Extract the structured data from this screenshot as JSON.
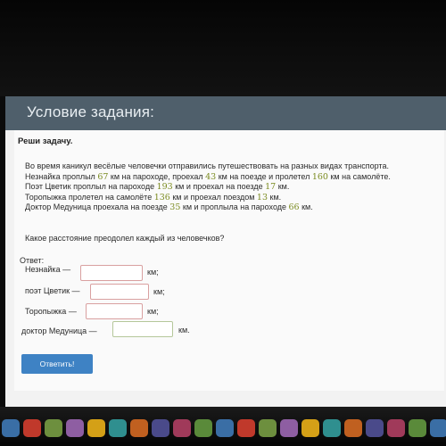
{
  "header": {
    "title": "Условие задания:"
  },
  "task": {
    "instruction": "Реши задачу.",
    "lines": [
      [
        "Во время каникул весёлые человечки отправились путешествовать на разных видах транспорта."
      ],
      [
        "Незнайка проплыл ",
        "67",
        " км на пароходе, проехал ",
        "43",
        " км на поезде и пролетел ",
        "160",
        " км на самолёте."
      ],
      [
        "Поэт Цветик проплыл на пароходе ",
        "193",
        " км и проехал на поезде ",
        "17",
        " км."
      ],
      [
        "Торопыжка пролетел на самолёте ",
        "136",
        " км и проехал поездом ",
        "13",
        " км."
      ],
      [
        "Доктор Медуница проехала на поезде ",
        "35",
        " км и проплыла на пароходе ",
        "66",
        " км."
      ]
    ],
    "question": "Какое расстояние преодолел каждый из человечков?"
  },
  "answers": {
    "title": "Ответ:",
    "rows": [
      {
        "label": "Незнайка —",
        "value": "",
        "unit": "км;"
      },
      {
        "label": "поэт Цветик —",
        "value": "",
        "unit": "км;"
      },
      {
        "label": "Торопыжка —",
        "value": "",
        "unit": "км;"
      },
      {
        "label": "доктор Медуница —",
        "value": "",
        "unit": "км."
      }
    ]
  },
  "submit_label": "Ответить!",
  "colors": {
    "header": "#4f5f6b",
    "button": "#3e82c4",
    "number": "#7a8a1e",
    "input_border": "#d9a0a0"
  },
  "dock": {
    "icons": [
      "app-icon",
      "calendar-icon",
      "app-icon",
      "app-icon",
      "app-icon",
      "app-icon",
      "app-icon",
      "app-icon",
      "app-icon",
      "app-icon",
      "app-icon",
      "app-icon",
      "app-icon",
      "app-icon",
      "app-icon",
      "app-icon",
      "app-icon",
      "app-icon",
      "app-icon",
      "app-icon",
      "app-icon"
    ]
  }
}
